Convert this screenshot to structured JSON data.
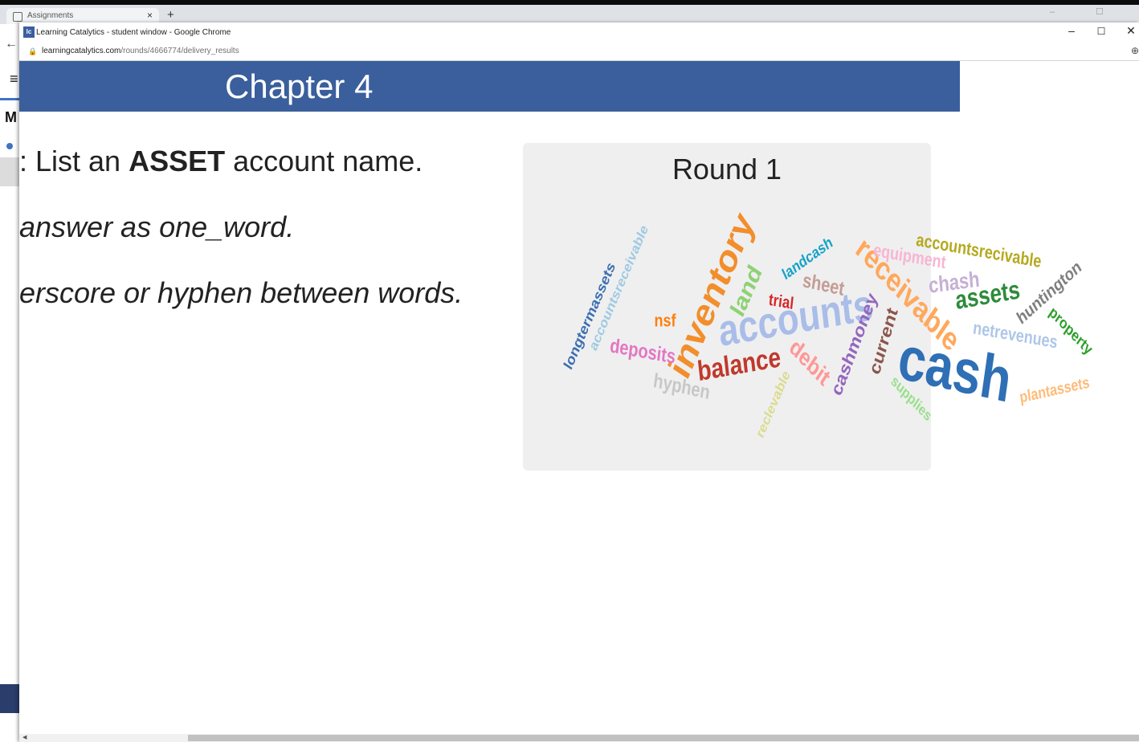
{
  "background_window": {
    "tab_label": "Assignments",
    "tab_close": "×",
    "new_tab": "+",
    "side_letter": "M"
  },
  "student_window": {
    "icon_text": "lc",
    "title": "Learning Catalytics - student window - Google Chrome",
    "controls": {
      "minimize": "–",
      "maximize": "☐",
      "close": "✕"
    },
    "url_host": "learningcatalytics.com",
    "url_path": "/rounds/4666774/delivery_results"
  },
  "banner": {
    "title": "Chapter 4"
  },
  "question": {
    "line1_prefix": ": List an ",
    "line1_bold": "ASSET",
    "line1_suffix": " account name.",
    "line2": "answer as one_word.",
    "line3": "erscore or hyphen between words."
  },
  "results": {
    "round_title": "Round 1",
    "words": [
      {
        "text": "cash",
        "color": "#2f6fb5"
      },
      {
        "text": "accounts",
        "color": "#a9bde8"
      },
      {
        "text": "inventory",
        "color": "#f28e2b"
      },
      {
        "text": "receivable",
        "color": "#ffa85c"
      },
      {
        "text": "balance",
        "color": "#c0392b"
      },
      {
        "text": "assets",
        "color": "#2e8b3a"
      },
      {
        "text": "accountsrecivable",
        "color": "#b5a91e"
      },
      {
        "text": "cashmoney",
        "color": "#9467bd"
      },
      {
        "text": "current",
        "color": "#8c564b"
      },
      {
        "text": "land",
        "color": "#8fd175"
      },
      {
        "text": "deposits",
        "color": "#e377c2"
      },
      {
        "text": "equipment",
        "color": "#f7b6d2"
      },
      {
        "text": "chash",
        "color": "#c5b0d5"
      },
      {
        "text": "sheet",
        "color": "#c49c94"
      },
      {
        "text": "debit",
        "color": "#ff9896"
      },
      {
        "text": "huntington",
        "color": "#7f7f7f"
      },
      {
        "text": "netrevenues",
        "color": "#aec7e8"
      },
      {
        "text": "property",
        "color": "#2ca02c"
      },
      {
        "text": "plantassets",
        "color": "#ffbb78"
      },
      {
        "text": "supplies",
        "color": "#98df8a"
      },
      {
        "text": "reclevable",
        "color": "#dbdb8d"
      },
      {
        "text": "hyphen",
        "color": "#c7c7c7"
      },
      {
        "text": "longtermassets",
        "color": "#3c6fb0"
      },
      {
        "text": "accountsreceivable",
        "color": "#9ecae1"
      },
      {
        "text": "landcash",
        "color": "#17a2c7"
      },
      {
        "text": "nsf",
        "color": "#ff7f0e"
      },
      {
        "text": "trial",
        "color": "#d62728"
      }
    ]
  }
}
